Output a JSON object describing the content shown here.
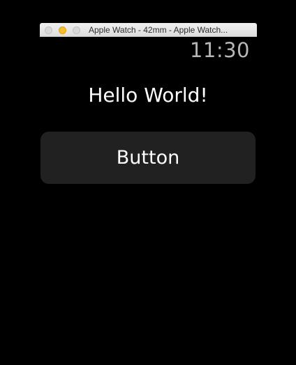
{
  "window": {
    "title": "Apple Watch - 42mm - Apple Watch...",
    "controls": [
      "close-icon",
      "minimize-icon",
      "zoom-icon"
    ]
  },
  "watch": {
    "time": "11:30",
    "label": "Hello World!",
    "button_label": "Button"
  },
  "colors": {
    "background": "#000000",
    "button_background": "#212122",
    "time_text": "#b7b7b7",
    "text": "#ffffff",
    "minimize_light": "#f5bd2a"
  }
}
